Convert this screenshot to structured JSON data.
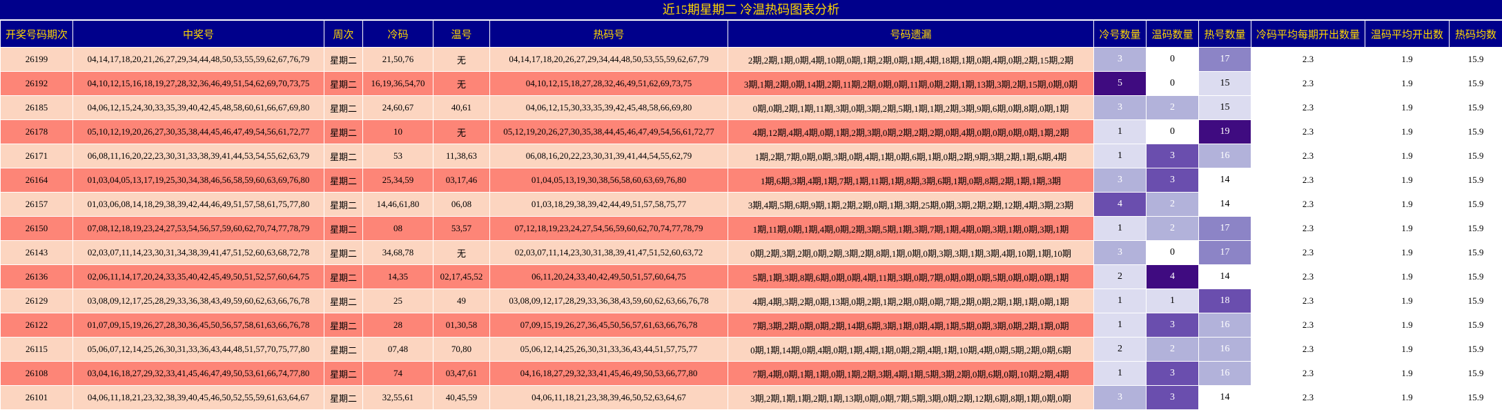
{
  "title": "近15期星期二 冷温热码图表分析",
  "columns": [
    "开奖号码期次",
    "中奖号",
    "周次",
    "冷码",
    "温号",
    "热码号",
    "号码遗漏",
    "冷号数量",
    "温码数量",
    "热号数量",
    "冷码平均每期开出数量",
    "温码平均开出数",
    "热码均数"
  ],
  "colors": {
    "header_bg": "#00008b",
    "header_text": "#ffd700",
    "row_light": "#fcd5c0",
    "row_dark": "#fd8577",
    "heat_scale": [
      "#ffffff",
      "#dcdcf0",
      "#b2b2da",
      "#8c84c6",
      "#6a4eae",
      "#3f0b80"
    ]
  },
  "chart_data": {
    "type": "table",
    "title": "近15期星期二 冷温热码图表分析",
    "rows": [
      {
        "period": "26199",
        "numbers": "04,14,17,18,20,21,26,27,29,34,44,48,50,53,55,59,62,67,76,79",
        "weekday": "星期二",
        "cold": "21,50,76",
        "warm": "无",
        "hot": "04,14,17,18,20,26,27,29,34,44,48,50,53,55,59,62,67,79",
        "missing": "2期,2期,1期,0期,4期,10期,0期,1期,2期,0期,1期,4期,18期,1期,0期,4期,0期,2期,15期,2期",
        "cold_count": 3,
        "warm_count": 0,
        "hot_count": 17,
        "cold_avg": "2.3",
        "warm_avg": "1.9",
        "hot_avg": "15.9"
      },
      {
        "period": "26192",
        "numbers": "04,10,12,15,16,18,19,27,28,32,36,46,49,51,54,62,69,70,73,75",
        "weekday": "星期二",
        "cold": "16,19,36,54,70",
        "warm": "无",
        "hot": "04,10,12,15,18,27,28,32,46,49,51,62,69,73,75",
        "missing": "3期,1期,2期,0期,14期,2期,11期,2期,0期,0期,11期,0期,2期,1期,13期,3期,2期,15期,0期,0期",
        "cold_count": 5,
        "warm_count": 0,
        "hot_count": 15,
        "cold_avg": "2.3",
        "warm_avg": "1.9",
        "hot_avg": "15.9"
      },
      {
        "period": "26185",
        "numbers": "04,06,12,15,24,30,33,35,39,40,42,45,48,58,60,61,66,67,69,80",
        "weekday": "星期二",
        "cold": "24,60,67",
        "warm": "40,61",
        "hot": "04,06,12,15,30,33,35,39,42,45,48,58,66,69,80",
        "missing": "0期,0期,2期,1期,11期,3期,0期,3期,2期,5期,1期,1期,2期,3期,9期,6期,0期,8期,0期,1期",
        "cold_count": 3,
        "warm_count": 2,
        "hot_count": 15,
        "cold_avg": "2.3",
        "warm_avg": "1.9",
        "hot_avg": "15.9"
      },
      {
        "period": "26178",
        "numbers": "05,10,12,19,20,26,27,30,35,38,44,45,46,47,49,54,56,61,72,77",
        "weekday": "星期二",
        "cold": "10",
        "warm": "无",
        "hot": "05,12,19,20,26,27,30,35,38,44,45,46,47,49,54,56,61,72,77",
        "missing": "4期,12期,4期,4期,0期,1期,2期,3期,0期,2期,2期,2期,0期,4期,0期,0期,0期,0期,1期,2期",
        "cold_count": 1,
        "warm_count": 0,
        "hot_count": 19,
        "cold_avg": "2.3",
        "warm_avg": "1.9",
        "hot_avg": "15.9"
      },
      {
        "period": "26171",
        "numbers": "06,08,11,16,20,22,23,30,31,33,38,39,41,44,53,54,55,62,63,79",
        "weekday": "星期二",
        "cold": "53",
        "warm": "11,38,63",
        "hot": "06,08,16,20,22,23,30,31,39,41,44,54,55,62,79",
        "missing": "1期,2期,7期,0期,0期,3期,0期,4期,1期,0期,6期,1期,0期,2期,9期,3期,2期,1期,6期,4期",
        "cold_count": 1,
        "warm_count": 3,
        "hot_count": 16,
        "cold_avg": "2.3",
        "warm_avg": "1.9",
        "hot_avg": "15.9"
      },
      {
        "period": "26164",
        "numbers": "01,03,04,05,13,17,19,25,30,34,38,46,56,58,59,60,63,69,76,80",
        "weekday": "星期二",
        "cold": "25,34,59",
        "warm": "03,17,46",
        "hot": "01,04,05,13,19,30,38,56,58,60,63,69,76,80",
        "missing": "1期,6期,3期,4期,1期,7期,1期,11期,1期,8期,3期,6期,1期,0期,8期,2期,1期,1期,3期",
        "cold_count": 3,
        "warm_count": 3,
        "hot_count": 14,
        "cold_avg": "2.3",
        "warm_avg": "1.9",
        "hot_avg": "15.9"
      },
      {
        "period": "26157",
        "numbers": "01,03,06,08,14,18,29,38,39,42,44,46,49,51,57,58,61,75,77,80",
        "weekday": "星期二",
        "cold": "14,46,61,80",
        "warm": "06,08",
        "hot": "01,03,18,29,38,39,42,44,49,51,57,58,75,77",
        "missing": "3期,4期,5期,6期,9期,1期,2期,2期,0期,1期,3期,25期,0期,3期,2期,2期,12期,4期,3期,23期",
        "cold_count": 4,
        "warm_count": 2,
        "hot_count": 14,
        "cold_avg": "2.3",
        "warm_avg": "1.9",
        "hot_avg": "15.9"
      },
      {
        "period": "26150",
        "numbers": "07,08,12,18,19,23,24,27,53,54,56,57,59,60,62,70,74,77,78,79",
        "weekday": "星期二",
        "cold": "08",
        "warm": "53,57",
        "hot": "07,12,18,19,23,24,27,54,56,59,60,62,70,74,77,78,79",
        "missing": "1期,11期,0期,1期,4期,0期,2期,3期,5期,1期,3期,7期,1期,4期,0期,3期,1期,0期,3期,1期",
        "cold_count": 1,
        "warm_count": 2,
        "hot_count": 17,
        "cold_avg": "2.3",
        "warm_avg": "1.9",
        "hot_avg": "15.9"
      },
      {
        "period": "26143",
        "numbers": "02,03,07,11,14,23,30,31,34,38,39,41,47,51,52,60,63,68,72,78",
        "weekday": "星期二",
        "cold": "34,68,78",
        "warm": "无",
        "hot": "02,03,07,11,14,23,30,31,38,39,41,47,51,52,60,63,72",
        "missing": "0期,2期,3期,2期,0期,2期,3期,2期,8期,1期,0期,0期,3期,3期,1期,3期,4期,10期,1期,10期",
        "cold_count": 3,
        "warm_count": 0,
        "hot_count": 17,
        "cold_avg": "2.3",
        "warm_avg": "1.9",
        "hot_avg": "15.9"
      },
      {
        "period": "26136",
        "numbers": "02,06,11,14,17,20,24,33,35,40,42,45,49,50,51,52,57,60,64,75",
        "weekday": "星期二",
        "cold": "14,35",
        "warm": "02,17,45,52",
        "hot": "06,11,20,24,33,40,42,49,50,51,57,60,64,75",
        "missing": "5期,1期,3期,8期,6期,0期,0期,4期,11期,3期,0期,7期,0期,0期,0期,5期,0期,0期,0期,1期",
        "cold_count": 2,
        "warm_count": 4,
        "hot_count": 14,
        "cold_avg": "2.3",
        "warm_avg": "1.9",
        "hot_avg": "15.9"
      },
      {
        "period": "26129",
        "numbers": "03,08,09,12,17,25,28,29,33,36,38,43,49,59,60,62,63,66,76,78",
        "weekday": "星期二",
        "cold": "25",
        "warm": "49",
        "hot": "03,08,09,12,17,28,29,33,36,38,43,59,60,62,63,66,76,78",
        "missing": "4期,4期,3期,2期,0期,13期,0期,2期,1期,2期,0期,0期,7期,2期,0期,2期,1期,1期,0期,1期",
        "cold_count": 1,
        "warm_count": 1,
        "hot_count": 18,
        "cold_avg": "2.3",
        "warm_avg": "1.9",
        "hot_avg": "15.9"
      },
      {
        "period": "26122",
        "numbers": "01,07,09,15,19,26,27,28,30,36,45,50,56,57,58,61,63,66,76,78",
        "weekday": "星期二",
        "cold": "28",
        "warm": "01,30,58",
        "hot": "07,09,15,19,26,27,36,45,50,56,57,61,63,66,76,78",
        "missing": "7期,3期,2期,0期,0期,2期,14期,6期,3期,1期,0期,4期,1期,5期,0期,3期,0期,2期,1期,0期",
        "cold_count": 1,
        "warm_count": 3,
        "hot_count": 16,
        "cold_avg": "2.3",
        "warm_avg": "1.9",
        "hot_avg": "15.9"
      },
      {
        "period": "26115",
        "numbers": "05,06,07,12,14,25,26,30,31,33,36,43,44,48,51,57,70,75,77,80",
        "weekday": "星期二",
        "cold": "07,48",
        "warm": "70,80",
        "hot": "05,06,12,14,25,26,30,31,33,36,43,44,51,57,75,77",
        "missing": "0期,1期,14期,0期,4期,0期,1期,4期,1期,0期,2期,4期,1期,10期,4期,0期,5期,2期,0期,6期",
        "cold_count": 2,
        "warm_count": 2,
        "hot_count": 16,
        "cold_avg": "2.3",
        "warm_avg": "1.9",
        "hot_avg": "15.9"
      },
      {
        "period": "26108",
        "numbers": "03,04,16,18,27,29,32,33,41,45,46,47,49,50,53,61,66,74,77,80",
        "weekday": "星期二",
        "cold": "74",
        "warm": "03,47,61",
        "hot": "04,16,18,27,29,32,33,41,45,46,49,50,53,66,77,80",
        "missing": "7期,4期,0期,1期,1期,0期,1期,2期,3期,4期,1期,5期,3期,2期,0期,6期,0期,10期,2期,4期",
        "cold_count": 1,
        "warm_count": 3,
        "hot_count": 16,
        "cold_avg": "2.3",
        "warm_avg": "1.9",
        "hot_avg": "15.9"
      },
      {
        "period": "26101",
        "numbers": "04,06,11,18,21,23,32,38,39,40,45,46,50,52,55,59,61,63,64,67",
        "weekday": "星期二",
        "cold": "32,55,61",
        "warm": "40,45,59",
        "hot": "04,06,11,18,21,23,38,39,46,50,52,63,64,67",
        "missing": "3期,2期,1期,1期,2期,1期,13期,0期,0期,7期,5期,3期,0期,2期,12期,6期,8期,1期,0期,0期",
        "cold_count": 3,
        "warm_count": 3,
        "hot_count": 14,
        "cold_avg": "2.3",
        "warm_avg": "1.9",
        "hot_avg": "15.9"
      }
    ]
  }
}
